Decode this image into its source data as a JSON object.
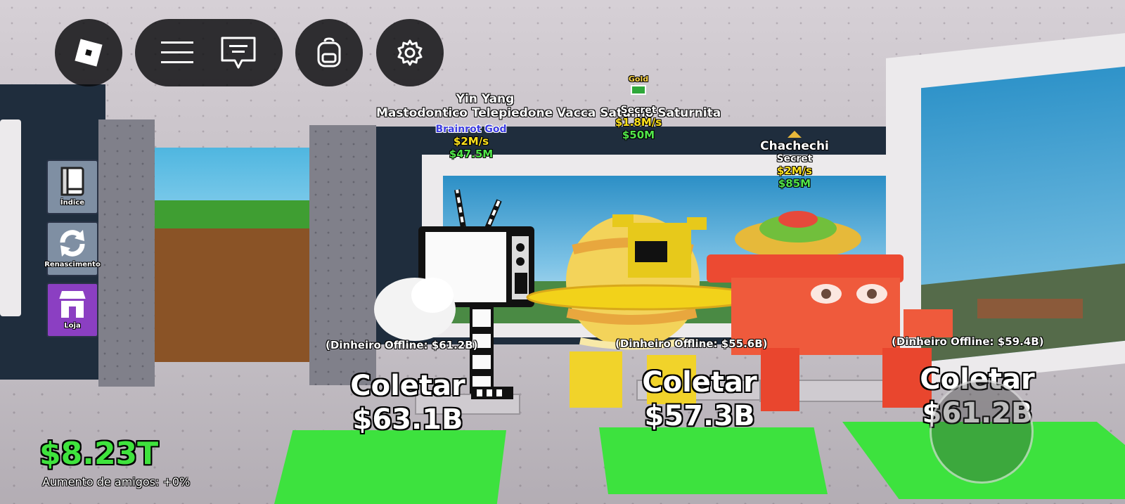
{
  "hud": {
    "roblox_menu_icon": "roblox-logo-icon",
    "menu_icon": "hamburger-menu-icon",
    "chat_icon": "chat-bubble-icon",
    "backpack_icon": "backpack-icon",
    "settings_icon": "gear-icon"
  },
  "side_menu": [
    {
      "label": "Índice",
      "icon": "book-icon",
      "color": "#7f8fa3"
    },
    {
      "label": "Renascimento",
      "icon": "refresh-icon",
      "color": "#7f8fa3"
    },
    {
      "label": "Loja",
      "icon": "shop-icon",
      "color": "#8b3fc2"
    }
  ],
  "stats": {
    "money": "$8.23T",
    "friends_boost": "Aumento de amigos: +0%"
  },
  "brainrots": [
    {
      "name_top": "Yin Yang",
      "name": "Mastodontico Telepiedone",
      "rarity": "Brainrot God",
      "rate": "$2M/s",
      "cost": "$47.5M",
      "offline": "(Dinheiro Offline: $61.2B)",
      "collect_label": "Coletar",
      "collect_amount": "$63.1B"
    },
    {
      "name_top": "Gold",
      "name": "Vacca Saturno Saturnita",
      "rarity": "Secret",
      "rate": "$1.8M/s",
      "cost": "$50M",
      "offline": "(Dinheiro Offline: $55.6B)",
      "collect_label": "Coletar",
      "collect_amount": "$57.3B"
    },
    {
      "name_top": "",
      "name": "Chachechi",
      "rarity": "Secret",
      "rate": "$2M/s",
      "cost": "$85M",
      "offline": "(Dinheiro Offline: $59.4B)",
      "collect_label": "Coletar",
      "collect_amount": "$61.2B"
    }
  ],
  "colors": {
    "money_green": "#3fe33d",
    "rate_yellow": "#ffe21d",
    "cost_green": "#52e64a",
    "pad_green": "#3de23e",
    "god_rarity": "#3b3be0",
    "secret_rarity": "#ffffff"
  }
}
